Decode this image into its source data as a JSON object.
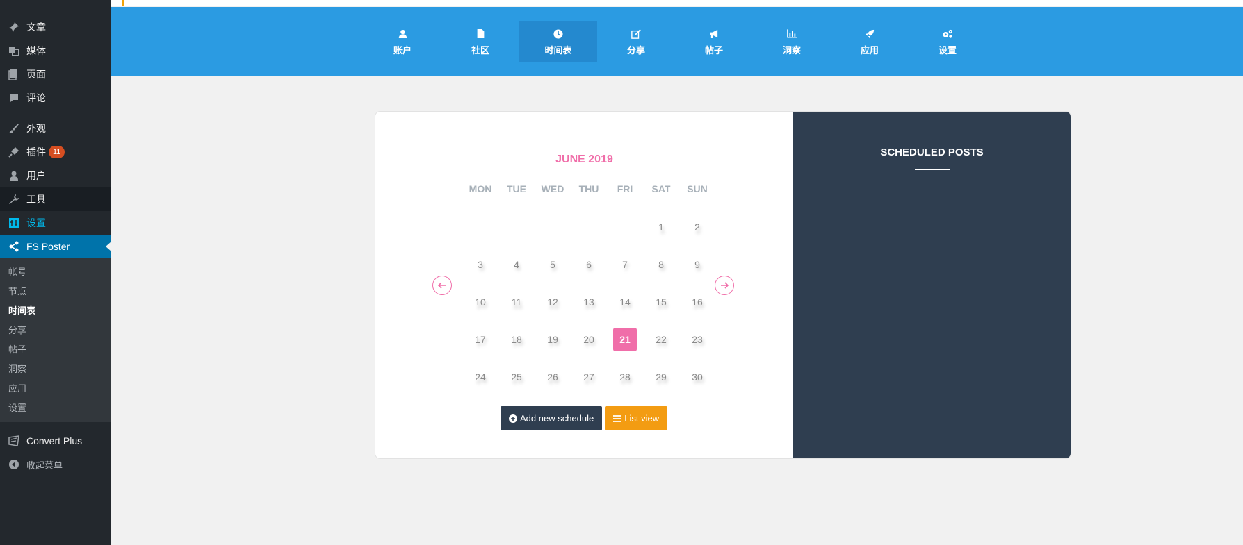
{
  "sidebar": {
    "items": [
      {
        "label": "文章",
        "icon": "pin-icon"
      },
      {
        "label": "媒体",
        "icon": "media-icon"
      },
      {
        "label": "页面",
        "icon": "page-icon"
      },
      {
        "label": "评论",
        "icon": "comment-icon"
      },
      {
        "label": "外观",
        "icon": "brush-icon"
      },
      {
        "label": "插件",
        "icon": "plugin-icon",
        "badge": "11"
      },
      {
        "label": "用户",
        "icon": "user-icon"
      },
      {
        "label": "工具",
        "icon": "wrench-icon"
      },
      {
        "label": "设置",
        "icon": "settings-icon"
      },
      {
        "label": "FS Poster",
        "icon": "share-icon"
      }
    ],
    "submenu": [
      "帐号",
      "节点",
      "时间表",
      "分享",
      "帖子",
      "洞察",
      "应用",
      "设置"
    ],
    "bottom": [
      {
        "label": "Convert Plus",
        "icon": "convert-icon"
      },
      {
        "label": "收起菜单",
        "icon": "collapse-icon"
      }
    ]
  },
  "nav": {
    "items": [
      {
        "label": "账户",
        "icon": "user-icon"
      },
      {
        "label": "社区",
        "icon": "file-icon"
      },
      {
        "label": "时间表",
        "icon": "clock-icon"
      },
      {
        "label": "分享",
        "icon": "edit-icon"
      },
      {
        "label": "帖子",
        "icon": "megaphone-icon"
      },
      {
        "label": "洞察",
        "icon": "bar-chart-icon"
      },
      {
        "label": "应用",
        "icon": "rocket-icon"
      },
      {
        "label": "设置",
        "icon": "cogs-icon"
      }
    ],
    "active_index": 2
  },
  "calendar": {
    "month_label": "JUNE 2019",
    "days_of_week": [
      "MON",
      "TUE",
      "WED",
      "THU",
      "FRI",
      "SAT",
      "SUN"
    ],
    "weeks": [
      [
        "",
        "",
        "",
        "",
        "",
        "1",
        "2"
      ],
      [
        "3",
        "4",
        "5",
        "6",
        "7",
        "8",
        "9"
      ],
      [
        "10",
        "11",
        "12",
        "13",
        "14",
        "15",
        "16"
      ],
      [
        "17",
        "18",
        "19",
        "20",
        "21",
        "22",
        "23"
      ],
      [
        "24",
        "25",
        "26",
        "27",
        "28",
        "29",
        "30"
      ]
    ],
    "today": "21",
    "add_button": "Add new schedule",
    "list_button": "List view"
  },
  "scheduled": {
    "title": "SCHEDULED POSTS"
  },
  "colors": {
    "accent_pink": "#f06ea9",
    "nav_blue": "#2b9be2",
    "dark_panel": "#2f3e50",
    "orange": "#f39c12",
    "wp_sidebar": "#23282d",
    "wp_active": "#0073aa"
  }
}
